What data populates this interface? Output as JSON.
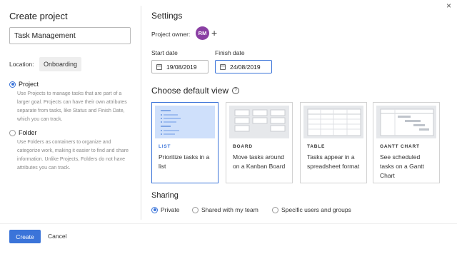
{
  "project": {
    "title": "Create project",
    "name_value": "Task Management",
    "location_label": "Location:",
    "location_value": "Onboarding",
    "type_options": [
      {
        "label": "Project",
        "selected": true,
        "description": "Use Projects to manage tasks that are part of a larger goal. Projects can have their own attributes separate from tasks, like Status and Finish Date, which you can track."
      },
      {
        "label": "Folder",
        "selected": false,
        "description": "Use Folders as containers to organize and categorize work, making it easier to find and share information. Unlike Projects, Folders do not have attributes you can track."
      }
    ]
  },
  "settings": {
    "title": "Settings",
    "owner_label": "Project owner:",
    "owner_initials": "RM",
    "owner_color": "#8a3fa3",
    "add_symbol": "+",
    "start_label": "Start date",
    "start_value": "19/08/2019",
    "finish_label": "Finish date",
    "finish_value": "24/08/2019"
  },
  "view": {
    "title": "Choose default view",
    "help_symbol": "?",
    "cards": [
      {
        "name": "LIST",
        "description": "Prioritize tasks in a list",
        "selected": true
      },
      {
        "name": "BOARD",
        "description": "Move tasks around on a Kanban Board",
        "selected": false
      },
      {
        "name": "TABLE",
        "description": "Tasks appear in a spreadsheet format",
        "selected": false
      },
      {
        "name": "GANTT CHART",
        "description": "See scheduled tasks on a Gantt Chart",
        "selected": false
      }
    ]
  },
  "sharing": {
    "title": "Sharing",
    "options": [
      {
        "label": "Private",
        "selected": true
      },
      {
        "label": "Shared with my team",
        "selected": false
      },
      {
        "label": "Specific users and groups",
        "selected": false
      }
    ]
  },
  "footer": {
    "create_label": "Create",
    "cancel_label": "Cancel"
  },
  "close_symbol": "×",
  "accent_color": "#3b74d9"
}
